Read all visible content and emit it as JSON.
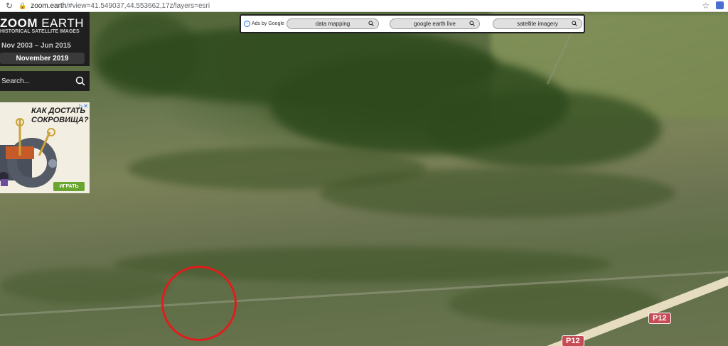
{
  "browser": {
    "url_host": "zoom.earth",
    "url_path": "/#view=41.549037,44.553662,17z/layers=esri",
    "icons": [
      "reload-icon",
      "lock-icon",
      "star-icon",
      "extension-icon"
    ]
  },
  "brand": {
    "logo_bold": "ZOOM",
    "logo_light": " EARTH",
    "subtitle": "HISTORICAL SATELLITE IMAGES",
    "date_range": "Nov 2003 – Jun 2015",
    "current_date": "November 2019"
  },
  "search": {
    "placeholder": "Search..."
  },
  "ad": {
    "title_line1": "КАК ДОСТАТЬ",
    "title_line2": "СОКРОВИЩА?",
    "button": "ИГРАТЬ",
    "choices_icon": "ad-choices-icon"
  },
  "google_ads": {
    "label": "Ads by Google",
    "pills": [
      "data mapping",
      "google earth live",
      "satellite imagery"
    ]
  },
  "map": {
    "road_signs": [
      "P12",
      "P12"
    ],
    "marker_color": "#e01d1d"
  },
  "colors": {
    "sidebar_bg": "#1f1f1f",
    "road_sign": "#c74b55"
  }
}
